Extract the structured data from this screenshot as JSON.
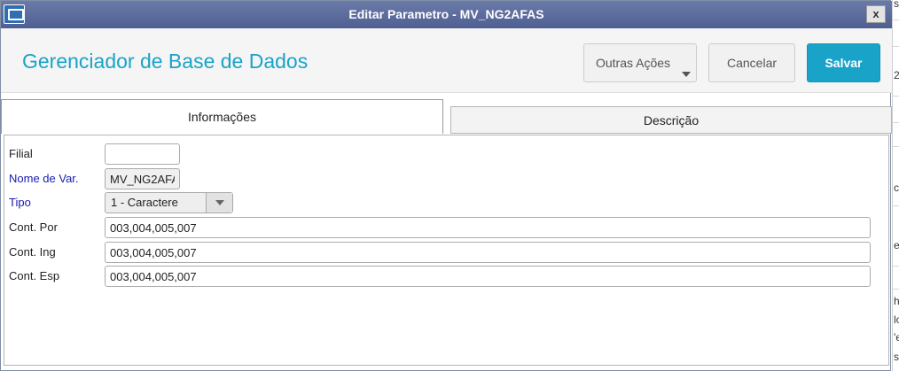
{
  "window": {
    "title": "Editar Parametro - MV_NG2AFAS",
    "icon": "app-icon",
    "close_label": "x"
  },
  "header": {
    "title": "Gerenciador de Base de Dados",
    "buttons": {
      "more_label": "Outras Ações",
      "cancel_label": "Cancelar",
      "save_label": "Salvar"
    },
    "accent_color": "#1aa3c8"
  },
  "tabs": [
    {
      "label": "Informações",
      "active": true
    },
    {
      "label": "Descrição",
      "active": false
    }
  ],
  "form": {
    "filial": {
      "label": "Filial",
      "value": ""
    },
    "nome_var": {
      "label": "Nome de Var.",
      "value": "MV_NG2AFA"
    },
    "tipo": {
      "label": "Tipo",
      "value": "1 - Caractere"
    },
    "cont_por": {
      "label": "Cont. Por",
      "value": "003,004,005,007"
    },
    "cont_ing": {
      "label": "Cont. Ing",
      "value": "003,004,005,007"
    },
    "cont_esp": {
      "label": "Cont. Esp",
      "value": "003,004,005,007"
    }
  },
  "background_fragments": [
    "s",
    "2",
    "c",
    "e",
    "h",
    "lo",
    "'e",
    "se"
  ]
}
